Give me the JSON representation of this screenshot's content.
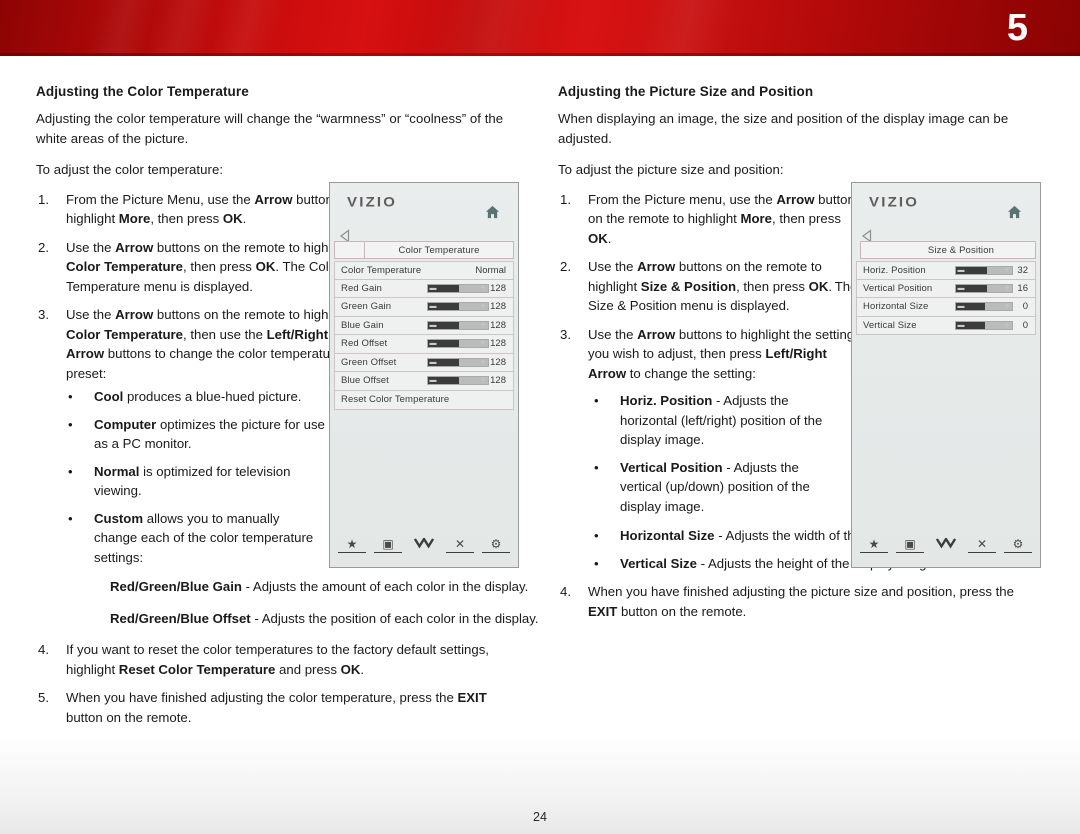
{
  "header": {
    "chapter_number": "5"
  },
  "page": {
    "number": "24"
  },
  "left_column": {
    "title": "Adjusting the Color Temperature",
    "intro": "Adjusting the color temperature will change the “warmness” or “coolness” of the white areas of the picture.",
    "lead_in": "To adjust the color temperature:",
    "steps": [
      {
        "num": "1.",
        "text_html": "From the Picture Menu, use the <b>Arrow</b> buttons to highlight <b>More</b>, then press <b>OK</b>."
      },
      {
        "num": "2.",
        "text_html": "Use the <b>Arrow</b> buttons on the remote to highlight <b>Color Temperature</b>, then press <b>OK</b>. The Color Temperature menu is displayed."
      },
      {
        "num": "3.",
        "text_html": "Use the <b>Arrow</b> buttons on the remote to highlight <b>Color Temperature</b>, then use the <b>Left/Right Arrow</b> buttons to change the color temperature preset:"
      },
      {
        "num": "4.",
        "text_html": "If you want to reset the color temperatures to the factory default settings, highlight <b>Reset Color Temperature</b> and press <b>OK</b>."
      },
      {
        "num": "5.",
        "text_html": "When you have finished adjusting the color temperature, press the <b>EXIT</b> button on the remote."
      }
    ],
    "presets": [
      {
        "bullet": "•",
        "text_html": "<b>Cool</b> produces a blue-hued picture."
      },
      {
        "bullet": "•",
        "text_html": "<b>Computer</b> optimizes the picture for use as a PC monitor."
      },
      {
        "bullet": "•",
        "text_html": "<b>Normal</b> is optimized for television viewing."
      },
      {
        "bullet": "•",
        "text_html": "<b>Custom</b> allows you to manually change each of the color temperature settings:"
      }
    ],
    "custom_settings": [
      {
        "text_html": "<b>Red/Green/Blue Gain</b> - Adjusts the amount of each color in the display."
      },
      {
        "text_html": "<b>Red/Green/Blue Offset</b> - Adjusts the position of each color in the display."
      }
    ]
  },
  "right_column": {
    "title": "Adjusting the Picture Size and Position",
    "intro": "When displaying an image, the size and position of the display image can be adjusted.",
    "lead_in": "To adjust the picture size and position:",
    "steps": [
      {
        "num": "1.",
        "text_html": "From the Picture menu, use the <b>Arrow</b> buttons on the remote to highlight <b>More</b>, then press <b>OK</b>."
      },
      {
        "num": "2.",
        "text_html": "Use the <b>Arrow</b> buttons on the remote to highlight <b>Size &amp; Position</b>, then press <b>OK</b>. The Size &amp; Position menu is displayed."
      },
      {
        "num": "3.",
        "text_html": "Use the <b>Arrow</b> buttons to highlight the setting you wish to adjust, then press <b>Left/Right Arrow</b> to change the setting:"
      },
      {
        "num": "4.",
        "text_html": "When you have finished adjusting the picture size and position, press the <b>EXIT</b> button on the remote."
      }
    ],
    "settings_narrow": [
      {
        "bullet": "•",
        "text_html": "<b>Horiz. Position</b> - Adjusts the horizontal (left/right) position of the display image."
      },
      {
        "bullet": "•",
        "text_html": "<b>Vertical Position</b> - Adjusts the vertical (up/down) position of the display image."
      }
    ],
    "settings_wide": [
      {
        "bullet": "•",
        "text_html": "<b>Horizontal Size</b> - Adjusts the width of the display image."
      },
      {
        "bullet": "•",
        "text_html": "<b>Vertical Size</b> - Adjusts the height of the display image."
      }
    ]
  },
  "osd_color_temperature": {
    "brand": "VIZIO",
    "home_icon": "home-icon",
    "back_icon": "back-arrow-icon",
    "menu_title": "Color Temperature",
    "rows": [
      {
        "label": "Color Temperature",
        "value": "Normal",
        "has_slider": false
      },
      {
        "label": "Red Gain",
        "value": "128",
        "has_slider": true,
        "fill_pct": 52
      },
      {
        "label": "Green Gain",
        "value": "128",
        "has_slider": true,
        "fill_pct": 52
      },
      {
        "label": "Blue Gain",
        "value": "128",
        "has_slider": true,
        "fill_pct": 52
      },
      {
        "label": "Red Offset",
        "value": "128",
        "has_slider": true,
        "fill_pct": 52
      },
      {
        "label": "Green Offset",
        "value": "128",
        "has_slider": true,
        "fill_pct": 52
      },
      {
        "label": "Blue Offset",
        "value": "128",
        "has_slider": true,
        "fill_pct": 52
      },
      {
        "label": "Reset Color Temperature",
        "value": "",
        "has_slider": false
      }
    ],
    "icon_bar": [
      {
        "name": "star-icon",
        "glyph": "★"
      },
      {
        "name": "picture-icon",
        "glyph": "▣"
      },
      {
        "name": "chevron-down-icon",
        "glyph": "ⅴ"
      },
      {
        "name": "close-x-icon",
        "glyph": "✕"
      },
      {
        "name": "gear-icon",
        "glyph": "⚙"
      }
    ]
  },
  "osd_size_position": {
    "brand": "VIZIO",
    "home_icon": "home-icon",
    "back_icon": "back-arrow-icon",
    "menu_title": "Size & Position",
    "rows": [
      {
        "label": "Horiz. Position",
        "value": "32",
        "has_slider": true,
        "fill_pct": 55
      },
      {
        "label": "Vertical Position",
        "value": "16",
        "has_slider": true,
        "fill_pct": 55
      },
      {
        "label": "Horizontal Size",
        "value": "0",
        "has_slider": true,
        "fill_pct": 52
      },
      {
        "label": "Vertical Size",
        "value": "0",
        "has_slider": true,
        "fill_pct": 52
      }
    ],
    "icon_bar": [
      {
        "name": "star-icon",
        "glyph": "★"
      },
      {
        "name": "picture-icon",
        "glyph": "▣"
      },
      {
        "name": "chevron-down-icon",
        "glyph": "ⅴ"
      },
      {
        "name": "close-x-icon",
        "glyph": "✕"
      },
      {
        "name": "gear-icon",
        "glyph": "⚙"
      }
    ]
  },
  "colors": {
    "banner_red": "#cc0d0d",
    "osd_bg": "#e6eae9",
    "osd_row_bg": "#eef1f0",
    "slider_fill": "#3b3b3b",
    "slider_track": "#b9bcbb"
  }
}
